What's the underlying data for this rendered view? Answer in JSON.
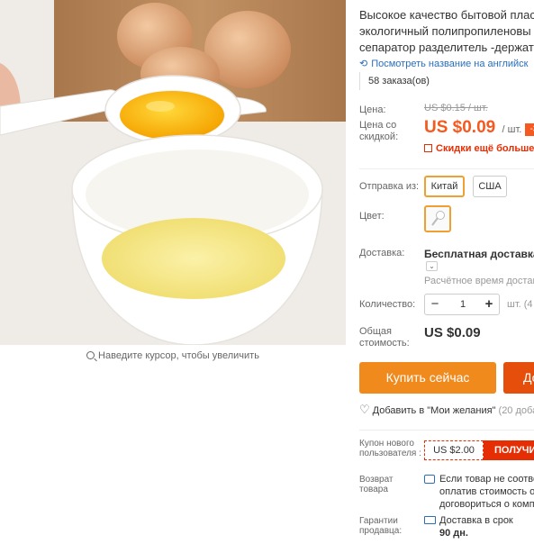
{
  "photo": {
    "alt": "egg separator",
    "zoom_hint": "Наведите курсор, чтобы увеличить"
  },
  "product": {
    "title_lines": [
      "Высокое качество бытовой плас",
      "экологичный полипропиленовы",
      "сепаратор разделитель -держате"
    ],
    "translate_link": "Посмотреть название на английск",
    "orders": "58 заказа(ов)"
  },
  "price": {
    "old_label": "Цена:",
    "old_value": "US $0.15 / шт.",
    "new_label": "Цена со скидкой:",
    "new_value": "US $0.09",
    "new_unit": "/ шт.",
    "discount_badge": "-3",
    "more_discounts": "Скидки ещё больше в"
  },
  "shipping_from": {
    "label": "Отправка из:",
    "options": [
      "Китай",
      "США"
    ],
    "selected": "Китай"
  },
  "color": {
    "label": "Цвет:"
  },
  "delivery": {
    "label": "Доставка:",
    "value": "Бесплатная доставка в",
    "toggle": "⌄",
    "estimate": "Расчётное время доставк"
  },
  "quantity": {
    "label": "Количество:",
    "value": "1",
    "minus": "−",
    "plus": "+",
    "unit": "шт. (4"
  },
  "total": {
    "label": "Общая стоимость:",
    "value": "US $0.09"
  },
  "actions": {
    "buy_now": "Купить сейчас",
    "add_to_cart": "До"
  },
  "wishlist": {
    "label": "Добавить в \"Мои желания\"",
    "count": "(20 доба"
  },
  "coupon": {
    "label": "Купон нового пользователя :",
    "amount": "US $2.00",
    "get": "ПОЛУЧИ"
  },
  "return_policy": {
    "label": "Возврат товара",
    "lines": [
      "Если товар не соответ",
      "оплатив стоимость об",
      "договориться о компе"
    ]
  },
  "guarantee": {
    "label": "Гарантии продавца:",
    "line1": "Доставка в срок",
    "line2": "90 дн."
  },
  "colors": {
    "accent_orange": "#f08a1d",
    "price_orange": "#f5591f",
    "alert_red": "#e62e04",
    "link_blue": "#2a6eb8",
    "selected_border": "#f0a030"
  }
}
